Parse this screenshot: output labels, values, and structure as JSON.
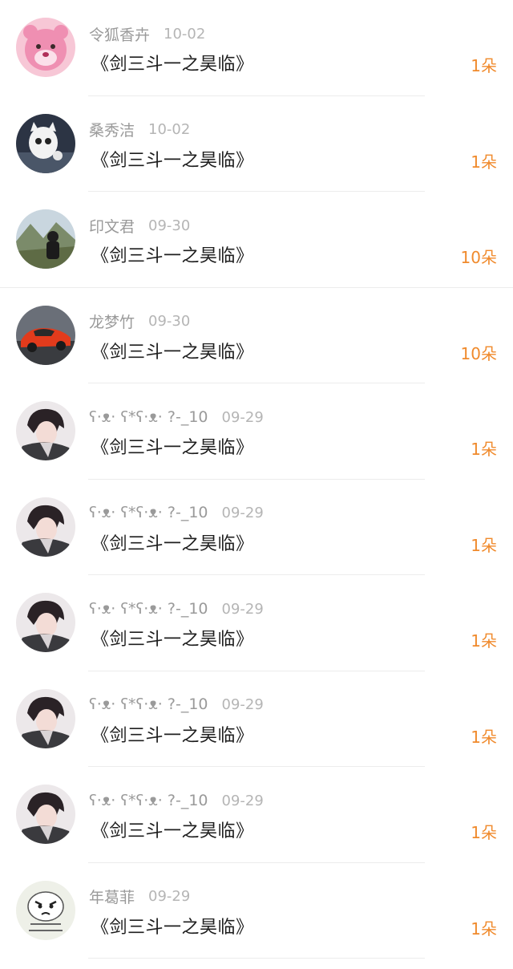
{
  "colors": {
    "name": "#9a9a9a",
    "date": "#b5b5b5",
    "title": "#1e1e1e",
    "count": "#f08a2c",
    "divider": "#ececec"
  },
  "gifts": [
    {
      "user": "令狐香卉",
      "date": "10-02",
      "book": "《剑三斗一之昊临》",
      "count": "1朵",
      "avatar": "pink-bear-avatar"
    },
    {
      "user": "桑秀洁",
      "date": "10-02",
      "book": "《剑三斗一之昊临》",
      "count": "1朵",
      "avatar": "white-cat-avatar"
    },
    {
      "user": "印文君",
      "date": "09-30",
      "book": "《剑三斗一之昊临》",
      "count": "10朵",
      "avatar": "mountain-person-avatar"
    },
    {
      "user": "龙梦竹",
      "date": "09-30",
      "book": "《剑三斗一之昊临》",
      "count": "10朵",
      "avatar": "red-car-avatar"
    },
    {
      "user": "ʕ·ᴥ· ʕ*ʕ·ᴥ· ?-_10",
      "date": "09-29",
      "book": "《剑三斗一之昊临》",
      "count": "1朵",
      "avatar": "anime-boy-avatar"
    },
    {
      "user": "ʕ·ᴥ· ʕ*ʕ·ᴥ· ?-_10",
      "date": "09-29",
      "book": "《剑三斗一之昊临》",
      "count": "1朵",
      "avatar": "anime-boy-avatar"
    },
    {
      "user": "ʕ·ᴥ· ʕ*ʕ·ᴥ· ?-_10",
      "date": "09-29",
      "book": "《剑三斗一之昊临》",
      "count": "1朵",
      "avatar": "anime-boy-avatar"
    },
    {
      "user": "ʕ·ᴥ· ʕ*ʕ·ᴥ· ?-_10",
      "date": "09-29",
      "book": "《剑三斗一之昊临》",
      "count": "1朵",
      "avatar": "anime-boy-avatar"
    },
    {
      "user": "ʕ·ᴥ· ʕ*ʕ·ᴥ· ?-_10",
      "date": "09-29",
      "book": "《剑三斗一之昊临》",
      "count": "1朵",
      "avatar": "anime-boy-avatar"
    },
    {
      "user": "年葛菲",
      "date": "09-29",
      "book": "《剑三斗一之昊临》",
      "count": "1朵",
      "avatar": "meme-face-avatar"
    }
  ]
}
